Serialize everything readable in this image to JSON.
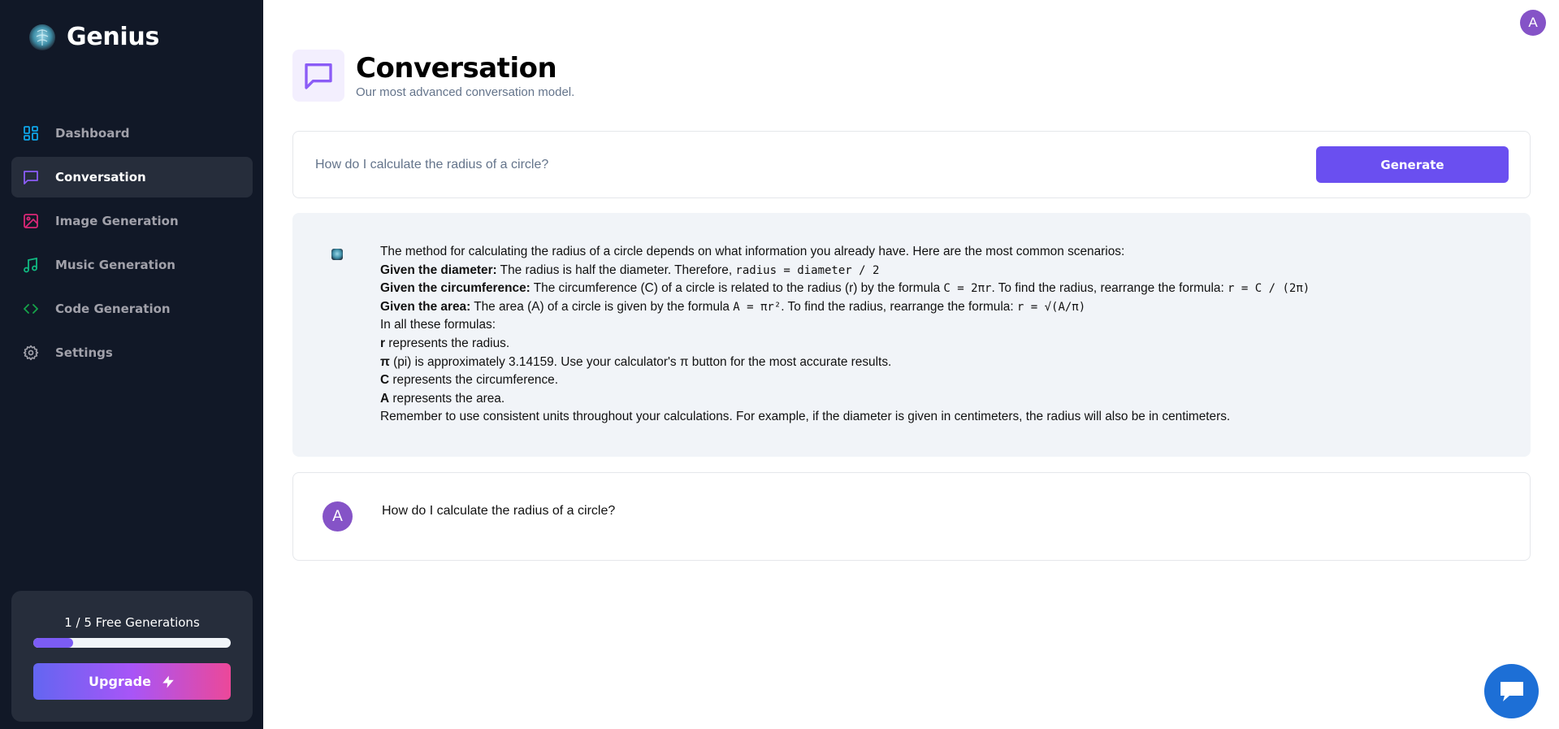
{
  "brand": {
    "name": "Genius",
    "logo_icon": "brain-logo-icon"
  },
  "sidebar": {
    "items": [
      {
        "label": "Dashboard",
        "icon": "dashboard-icon",
        "color": "#0ea5e9",
        "active": false
      },
      {
        "label": "Conversation",
        "icon": "message-square-icon",
        "color": "#8b5cf6",
        "active": true
      },
      {
        "label": "Image Generation",
        "icon": "image-icon",
        "color": "#db2777",
        "active": false
      },
      {
        "label": "Music Generation",
        "icon": "music-icon",
        "color": "#10b981",
        "active": false
      },
      {
        "label": "Code Generation",
        "icon": "code-icon",
        "color": "#16a34a",
        "active": false
      },
      {
        "label": "Settings",
        "icon": "gear-icon",
        "color": "#a1a1aa",
        "active": false
      }
    ]
  },
  "usage": {
    "label": "1 / 5 Free Generations",
    "used": 1,
    "limit": 5,
    "upgrade_label": "Upgrade",
    "upgrade_icon": "zap-icon"
  },
  "header": {
    "user_initial": "A",
    "title": "Conversation",
    "subtitle": "Our most advanced conversation model.",
    "icon": "message-square-icon",
    "accent": "#8b5cf6"
  },
  "prompt": {
    "placeholder": "How do I calculate the radius of a circle?",
    "value": "",
    "generate_label": "Generate"
  },
  "messages": {
    "bot": {
      "intro": "The method for calculating the radius of a circle depends on what information you already have. Here are the most common scenarios:",
      "diameter_label": "Given the diameter:",
      "diameter_text": " The radius is half the diameter. Therefore, ",
      "diameter_formula": "radius = diameter / 2",
      "circ_label": "Given the circumference:",
      "circ_text1": " The circumference (C) of a circle is related to the radius (r) by the formula ",
      "circ_formula1": "C = 2πr",
      "circ_text2": ". To find the radius, rearrange the formula: ",
      "circ_formula2": "r = C / (2π)",
      "area_label": "Given the area:",
      "area_text1": " The area (A) of a circle is given by the formula ",
      "area_formula1": "A = πr²",
      "area_text2": ". To find the radius, rearrange the formula: ",
      "area_formula2": "r = √(A/π)",
      "formulas_intro": "In all these formulas:",
      "r_label": "r",
      "r_text": " represents the radius.",
      "pi_label": "π",
      "pi_text": " (pi) is approximately 3.14159. Use your calculator's π button for the most accurate results.",
      "c_label": "C",
      "c_text": " represents the circumference.",
      "a_label": "A",
      "a_text": " represents the area.",
      "closing": "Remember to use consistent units throughout your calculations. For example, if the diameter is given in centimeters, the radius will also be in centimeters."
    },
    "user": {
      "initial": "A",
      "text": "How do I calculate the radius of a circle?"
    }
  },
  "support": {
    "icon": "chat-bubble-icon"
  }
}
